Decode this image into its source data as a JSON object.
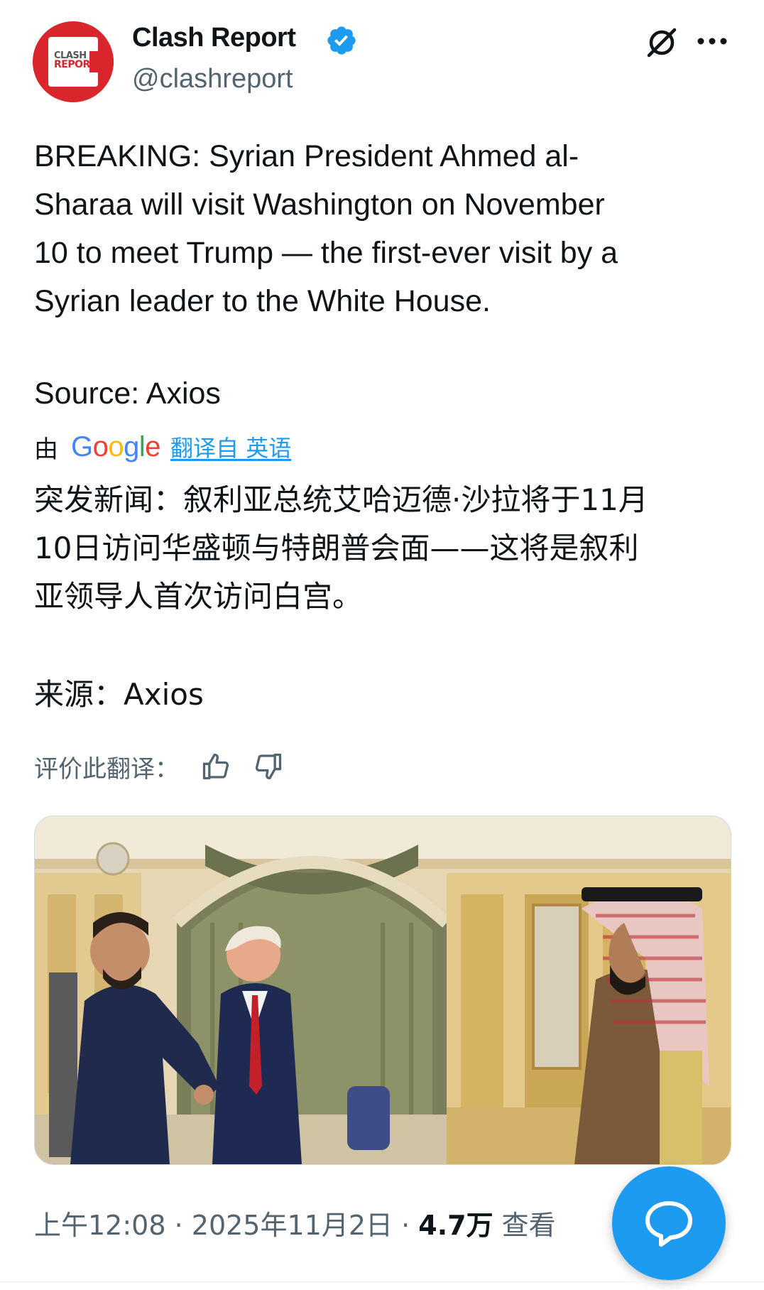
{
  "header": {
    "display_name": "Clash Report",
    "handle": "@clashreport",
    "avatar_text_line1": "CLASH",
    "avatar_text_line2": "REPORT",
    "verified_icon": "verified-badge",
    "grok_icon": "grok-icon",
    "more_icon": "more-dots-icon"
  },
  "tweet": {
    "text": "BREAKING: Syrian President Ahmed al-\nSharaa will visit Washington on November\n10 to meet Trump — the first-ever visit by a\nSyrian leader to the White House.",
    "source": "Source: Axios"
  },
  "translation": {
    "by_label": "由",
    "google_letters": [
      "G",
      "o",
      "o",
      "g",
      "l",
      "e"
    ],
    "link_label": "翻译自 英语",
    "text": "突发新闻：叙利亚总统艾哈迈德·沙拉将于11月\n10日访问华盛顿与特朗普会面——这将是叙利\n亚领导人首次访问白宫。",
    "source": "来源：Axios",
    "rate_label": "评价此翻译："
  },
  "footer": {
    "time": "上午12:08",
    "sep1": " · ",
    "date": "2025年11月2日",
    "sep2": " · ",
    "views": "4.7万",
    "views_label": " 查看"
  },
  "colors": {
    "accent": "#1d9bf0",
    "brand_red": "#d9262c",
    "secondary_text": "#536471",
    "google_blue": "#4285f4",
    "google_red": "#ea4335",
    "google_yellow": "#fbbc05",
    "google_green": "#34a853"
  }
}
